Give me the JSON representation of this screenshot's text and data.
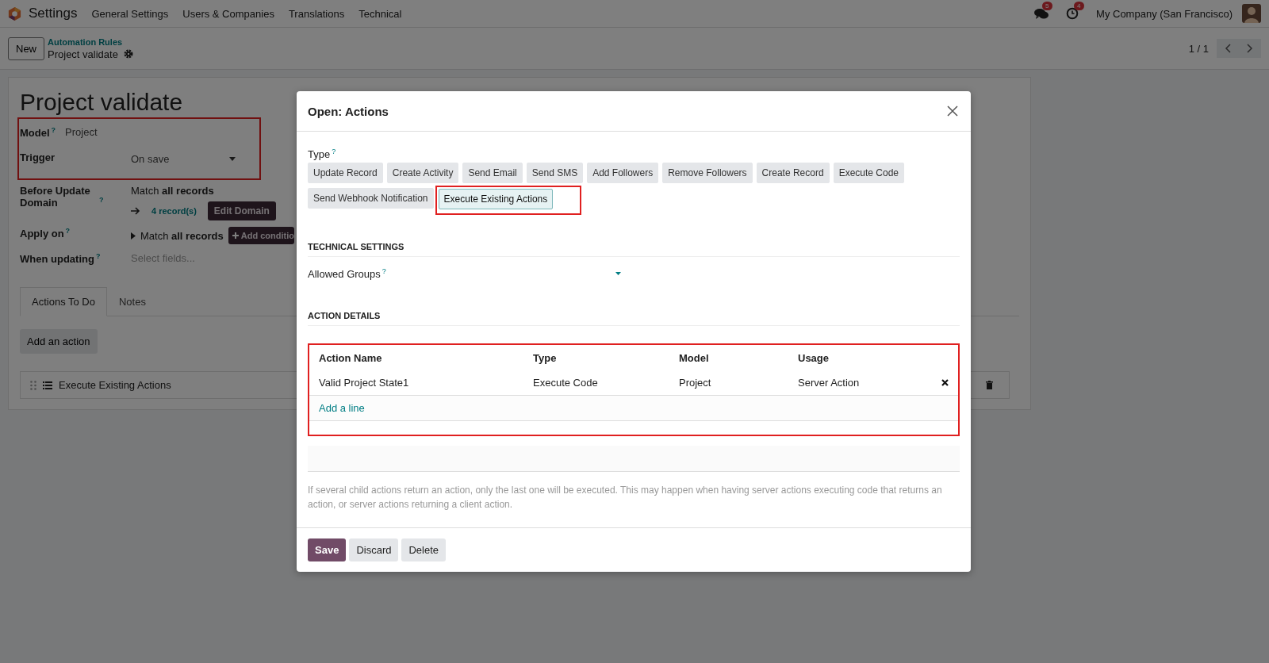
{
  "navbar": {
    "app_name": "Settings",
    "menus": [
      "General Settings",
      "Users & Companies",
      "Translations",
      "Technical"
    ],
    "messages_badge": "5",
    "activities_badge": "4",
    "company": "My Company (San Francisco)"
  },
  "control_panel": {
    "new_button": "New",
    "breadcrumb": "Automation Rules",
    "record": "Project validate",
    "pager": "1 / 1"
  },
  "form": {
    "title": "Project validate",
    "fields": [
      {
        "kind": "text",
        "label": "Model",
        "help": "?",
        "value": "Project"
      },
      {
        "kind": "select",
        "label": "Trigger",
        "value": "On save"
      },
      {
        "kind": "domain",
        "label": "Before Update Domain",
        "help": "?",
        "value": "Match **all records**",
        "records": "4 record(s)",
        "button": "Edit Domain"
      },
      {
        "kind": "tree",
        "label": "Apply on",
        "help": "?",
        "value": "Match **all records**",
        "button": "Add conditio"
      },
      {
        "kind": "placeholder",
        "label": "When updating",
        "help": "?",
        "placeholder": "Select fields..."
      }
    ],
    "tabs": [
      {
        "label": "Actions To Do",
        "selected": true
      },
      {
        "label": "Notes",
        "selected": false
      }
    ],
    "add_action_button": "Add an action",
    "action_rows": [
      {
        "name": "Execute Existing Actions"
      }
    ]
  },
  "dialog": {
    "title": "Open: Actions",
    "type_label": "Type",
    "type_help": "?",
    "types": [
      {
        "label": "Update Record",
        "selected": false
      },
      {
        "label": "Create Activity",
        "selected": false
      },
      {
        "label": "Send Email",
        "selected": false
      },
      {
        "label": "Send SMS",
        "selected": false
      },
      {
        "label": "Add Followers",
        "selected": false
      },
      {
        "label": "Remove Followers",
        "selected": false
      },
      {
        "label": "Create Record",
        "selected": false
      },
      {
        "label": "Execute Code",
        "selected": false
      },
      {
        "label": "Send Webhook Notification",
        "selected": false
      },
      {
        "label": "Execute Existing Actions",
        "selected": true
      }
    ],
    "technical_heading": "TECHNICAL SETTINGS",
    "allowed_groups_label": "Allowed Groups",
    "allowed_groups_help": "?",
    "details_heading": "ACTION DETAILS",
    "table": {
      "columns": [
        "Action Name",
        "Type",
        "Model",
        "Usage"
      ],
      "rows": [
        [
          "Valid Project State1",
          "Execute Code",
          "Project",
          "Server Action"
        ]
      ],
      "add_line": "Add a line"
    },
    "note": "If several child actions return an action, only the last one will be executed. This may happen when having server actions executing code that returns an action, or server actions returning a client action.",
    "buttons": [
      {
        "label": "Save",
        "kind": "primary"
      },
      {
        "label": "Discard",
        "kind": "secondary"
      },
      {
        "label": "Delete",
        "kind": "secondary"
      }
    ]
  }
}
